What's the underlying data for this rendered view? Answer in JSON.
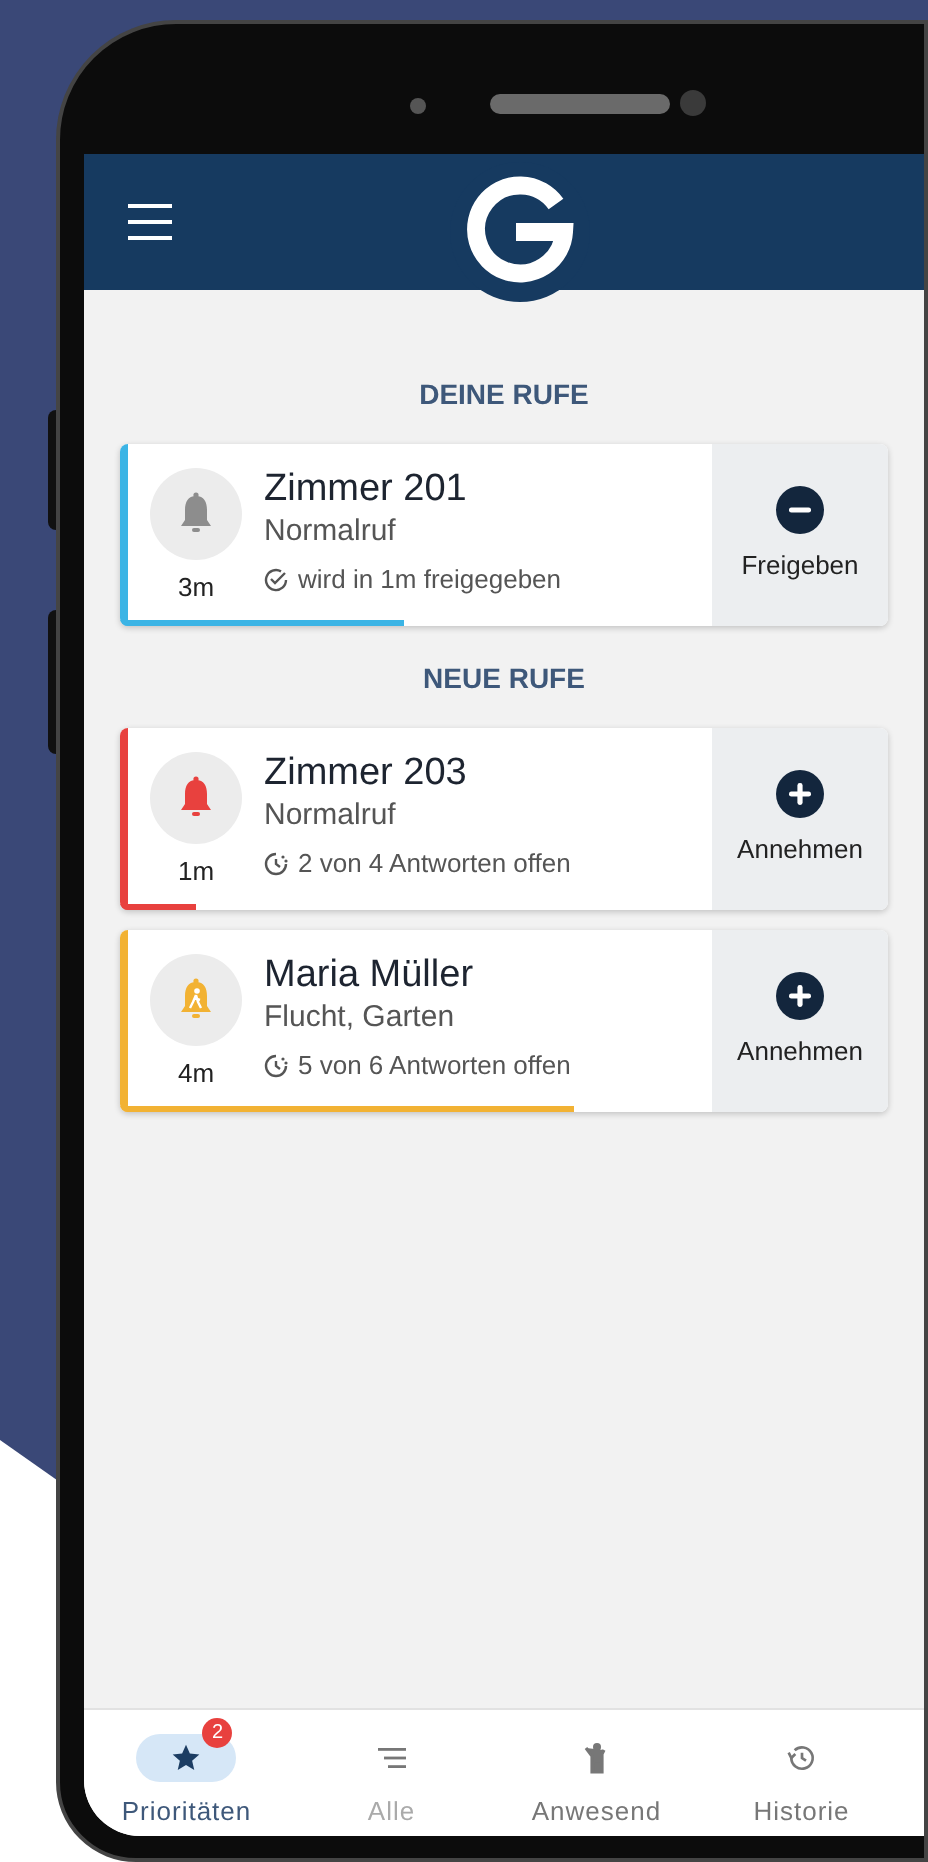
{
  "sections": [
    {
      "title": "DEINE RUFE",
      "kind": "own",
      "calls": [
        {
          "name": "Zimmer 201",
          "type": "Normalruf",
          "age": "3m",
          "status": "wird in 1m freigegeben",
          "kind": "normal",
          "color": "#3bb4e5",
          "level": 0.37,
          "action": "Freigeben"
        }
      ]
    },
    {
      "title": "NEUE RUFE",
      "kind": "new",
      "calls": [
        {
          "name": "Zimmer 203",
          "type": "Normalruf",
          "age": "1m",
          "status": "2 von 4 Antworten offen",
          "kind": "normal",
          "color": "#e8413e",
          "level": 0.1,
          "action": "Annehmen"
        },
        {
          "name": "Maria Müller",
          "type": "Flucht, Garten",
          "age": "4m",
          "status": "5 von 6 Antworten offen",
          "kind": "escape",
          "color": "#f2b233",
          "level": 0.59,
          "action": "Annehmen"
        }
      ]
    }
  ],
  "nav": [
    {
      "label": "Prioritäten",
      "selected": true,
      "badge": "2"
    },
    {
      "label": "Alle",
      "selected": false
    },
    {
      "label": "Anwesend",
      "selected": false
    },
    {
      "label": "Historie",
      "selected": false
    }
  ]
}
